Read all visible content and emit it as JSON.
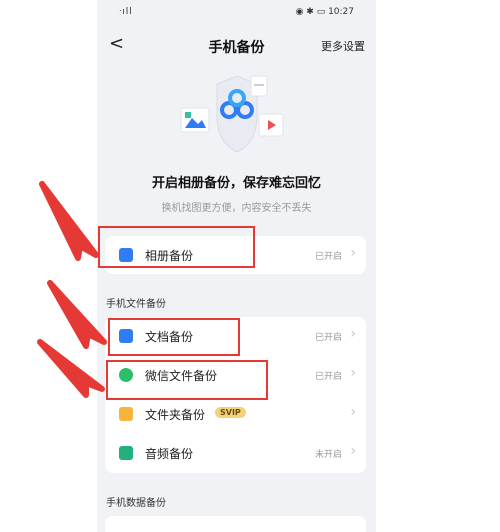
{
  "status_bar": {
    "signal": "ᐧıll",
    "battery_time": "10:27"
  },
  "nav": {
    "back": "<",
    "title": "手机备份",
    "more_settings": "更多设置"
  },
  "hero": {
    "title": "开启相册备份，保存难忘回忆",
    "subtitle": "换机找图更方便，内容安全不丢失"
  },
  "album_row": {
    "label": "相册备份",
    "status": "已开启",
    "chevron": "›"
  },
  "file_section": {
    "header": "手机文件备份",
    "rows": [
      {
        "label": "文档备份",
        "status": "已开启",
        "chevron": "›",
        "icon_color": "#2f7cf6"
      },
      {
        "label": "微信文件备份",
        "status": "已开启",
        "chevron": "›",
        "icon_color": "#2bbf6a"
      },
      {
        "label": "文件夹备份",
        "status": "",
        "chevron": "›",
        "badge": "SVIP",
        "icon_color": "#f6b53a"
      },
      {
        "label": "音频备份",
        "status": "未开启",
        "chevron": "›",
        "icon_color": "#22b07d"
      }
    ]
  },
  "data_section": {
    "header": "手机数据备份"
  },
  "colors": {
    "accent": "#2f7cf6",
    "annotation": "#e53935"
  }
}
